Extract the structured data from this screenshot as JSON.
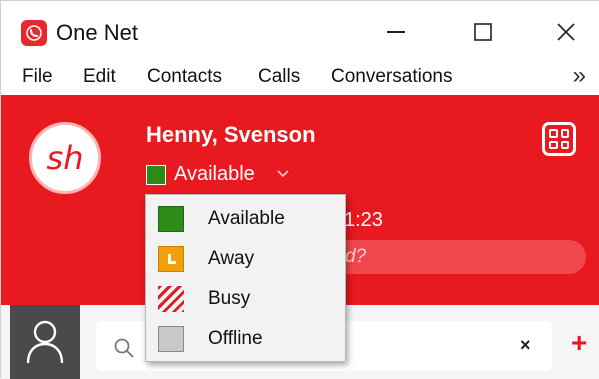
{
  "app": {
    "title": "One Net"
  },
  "menu": {
    "items": [
      "File",
      "Edit",
      "Contacts",
      "Calls",
      "Conversations"
    ],
    "more": "»"
  },
  "profile": {
    "initials": "sh",
    "name": "Henny, Svenson",
    "status": "Available",
    "status_color": "#2e8b18",
    "time_fragment": "1:23",
    "note_placeholder_fragment": "d?"
  },
  "status_menu": {
    "items": [
      {
        "label": "Available",
        "icon": "available-icon",
        "color": "#2e8b18"
      },
      {
        "label": "Away",
        "icon": "away-icon",
        "color": "#f0a00a"
      },
      {
        "label": "Busy",
        "icon": "busy-icon",
        "color": "#e8191f"
      },
      {
        "label": "Offline",
        "icon": "offline-icon",
        "color": "#c8c8c8"
      }
    ]
  },
  "search": {
    "clear": "×",
    "add": "+"
  },
  "colors": {
    "brand": "#e8191f",
    "header_bg": "#e8191f"
  }
}
